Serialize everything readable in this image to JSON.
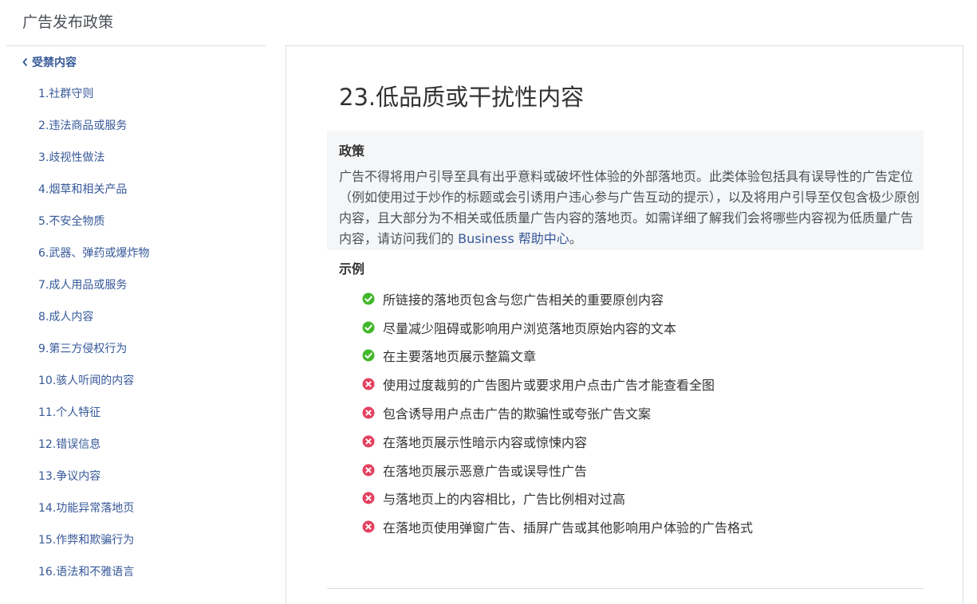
{
  "site": {
    "title": "广告发布政策"
  },
  "sidebar": {
    "section_label": "受禁内容",
    "items": [
      "1.社群守则",
      "2.违法商品或服务",
      "3.歧视性做法",
      "4.烟草和相关产品",
      "5.不安全物质",
      "6.武器、弹药或爆炸物",
      "7.成人用品或服务",
      "8.成人内容",
      "9.第三方侵权行为",
      "10.骇人听闻的内容",
      "11.个人特征",
      "12.错误信息",
      "13.争议内容",
      "14.功能异常落地页",
      "15.作弊和欺骗行为",
      "16.语法和不雅语言"
    ]
  },
  "article": {
    "title": "23.低品质或干扰性内容",
    "policy": {
      "heading": "政策",
      "body": "广告不得将用户引导至具有出乎意料或破坏性体验的外部落地页。此类体验包括具有误导性的广告定位（例如使用过于炒作的标题或会引诱用户违心参与广告互动的提示），以及将用户引导至仅包含极少原创内容，且大部分为不相关或低质量广告内容的落地页。如需详细了解我们会将哪些内容视为低质量广告内容，请访问我们的 ",
      "link_text": "Business 帮助中心",
      "trailing": "。"
    },
    "examples": {
      "heading": "示例",
      "items": [
        {
          "status": "allowed",
          "icon": "check-circle-icon",
          "text": "所链接的落地页包含与您广告相关的重要原创内容"
        },
        {
          "status": "allowed",
          "icon": "check-circle-icon",
          "text": "尽量减少阻碍或影响用户浏览落地页原始内容的文本"
        },
        {
          "status": "allowed",
          "icon": "check-circle-icon",
          "text": "在主要落地页展示整篇文章"
        },
        {
          "status": "prohibited",
          "icon": "x-circle-icon",
          "text": "使用过度裁剪的广告图片或要求用户点击广告才能查看全图"
        },
        {
          "status": "prohibited",
          "icon": "x-circle-icon",
          "text": "包含诱导用户点击广告的欺骗性或夸张广告文案"
        },
        {
          "status": "prohibited",
          "icon": "x-circle-icon",
          "text": "在落地页展示性暗示内容或惊悚内容"
        },
        {
          "status": "prohibited",
          "icon": "x-circle-icon",
          "text": "在落地页展示恶意广告或误导性广告"
        },
        {
          "status": "prohibited",
          "icon": "x-circle-icon",
          "text": "与落地页上的内容相比，广告比例相对过高"
        },
        {
          "status": "prohibited",
          "icon": "x-circle-icon",
          "text": "在落地页使用弹窗广告、插屏广告或其他影响用户体验的广告格式"
        }
      ]
    }
  },
  "colors": {
    "link": "#365899",
    "allowed": "#42b72a",
    "prohibited": "#e4405f",
    "policy_bg": "#f5f6f7",
    "border": "#dddfe2"
  },
  "icons": {
    "nav_back": "chevron-left-icon"
  }
}
